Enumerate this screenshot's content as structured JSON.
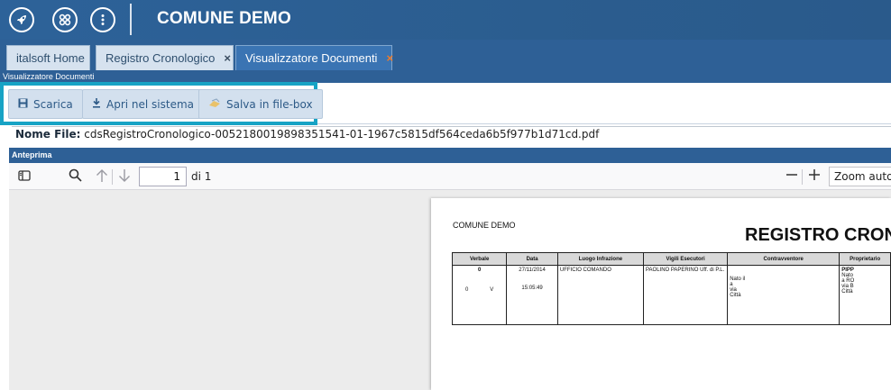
{
  "header": {
    "title": "COMUNE DEMO",
    "icons": [
      "rocket-icon",
      "apps-grid-icon",
      "more-vertical-icon"
    ]
  },
  "tabs": [
    {
      "label": "italsoft Home",
      "closable": false,
      "active": false
    },
    {
      "label": "Registro Cronologico",
      "closable": true,
      "active": false,
      "close": "×"
    },
    {
      "label": "Visualizzatore Documenti",
      "closable": true,
      "active": true,
      "close": "×"
    }
  ],
  "panel": {
    "title": "Visualizzatore Documenti"
  },
  "toolbar": {
    "download_label": "Scarica",
    "open_system_label": "Apri nel sistema",
    "save_filebox_label": "Salva in file-box"
  },
  "file": {
    "label": "Nome File:",
    "name": "cdsRegistroCronologico-005218001989835154​1-01-1967c5815df564ceda6b5f977b1d71cd.pdf"
  },
  "preview": {
    "title": "Anteprima",
    "page_current": "1",
    "page_total_text": "di 1",
    "zoom": "Zoom automatico"
  },
  "document": {
    "comune": "COMUNE DEMO",
    "title": "REGISTRO CRONOLOGICO",
    "columns": [
      "Verbale",
      "Data",
      "Luogo Infrazione",
      "Vigili Esecutori",
      "Contravventore",
      "Proprietario"
    ],
    "row": {
      "verbale_num": "0",
      "verbale_sub_a": "0",
      "verbale_sub_b": "V",
      "date": "27/11/2014",
      "time": "15:05:49",
      "luogo": "UFFICIO COMANDO",
      "vigili": "PAOLINO PAPERINO  Uff. di P.L.",
      "contr_lines": [
        "Nato il",
        "a",
        "via",
        "Città"
      ],
      "prop_lines": [
        "PIPP",
        "Nato",
        "a RO",
        "via B",
        "Città"
      ]
    }
  }
}
